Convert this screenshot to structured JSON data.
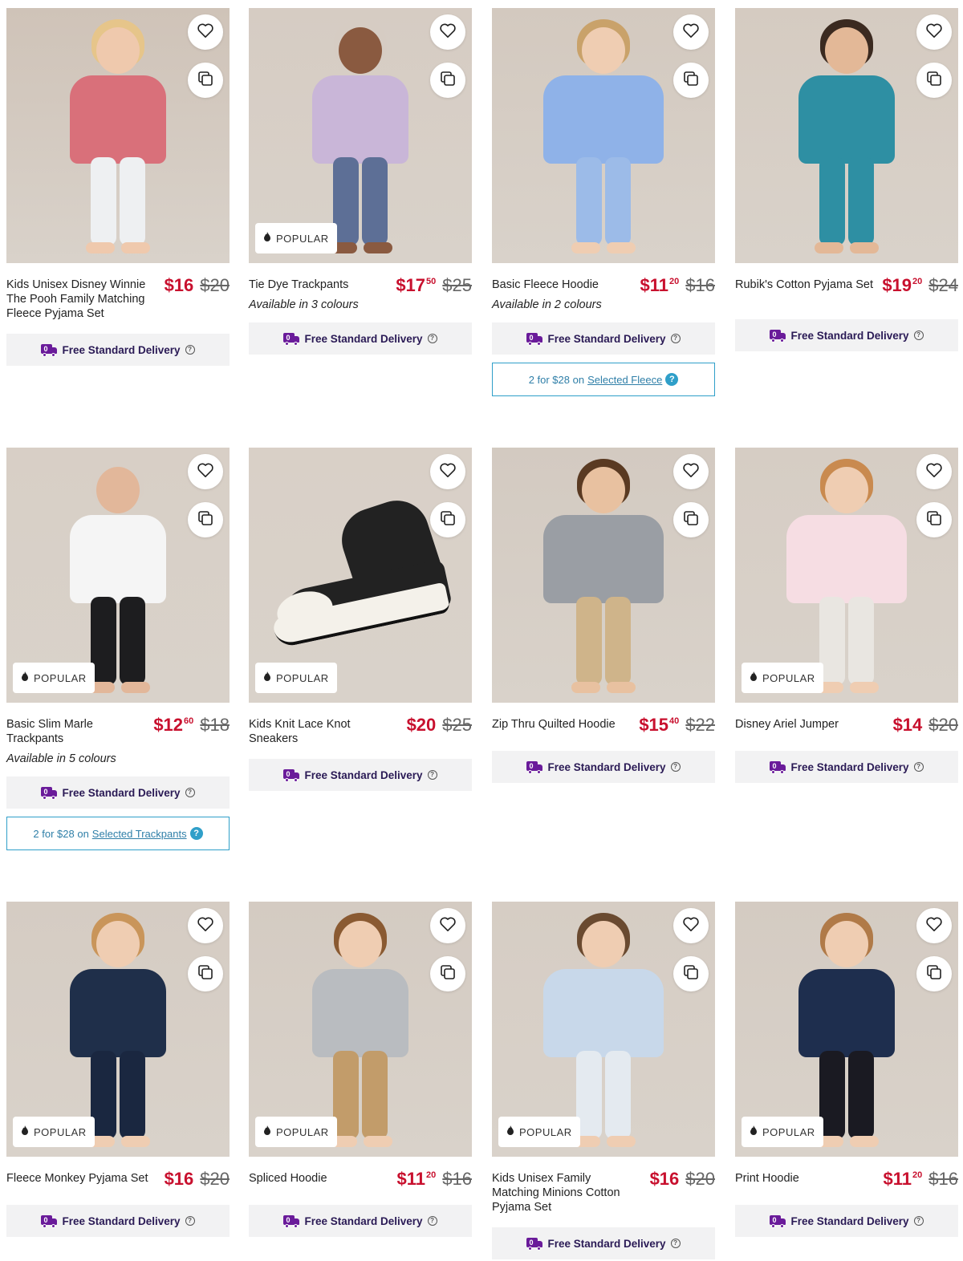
{
  "ui": {
    "popular_label": "POPULAR",
    "delivery_label": "Free Standard Delivery",
    "help_glyph": "?"
  },
  "products": [
    {
      "name": "Kids Unisex Disney Winnie The Pooh Family Matching Fleece Pyjama Set",
      "price_main": "$16",
      "price_cents": "",
      "was": "$20",
      "colours": "",
      "popular": false,
      "promo": null,
      "palette": {
        "bg": "#cfc3b8",
        "top": "#d9707a",
        "bottom": "#eef0f2",
        "hair": "#e6c58a",
        "skin": "#efc9ad"
      }
    },
    {
      "name": "Tie Dye Trackpants",
      "price_main": "$17",
      "price_cents": "50",
      "was": "$25",
      "colours": "Available in 3 colours",
      "popular": true,
      "promo": null,
      "palette": {
        "bg": "#d6ccc3",
        "top": "#c9b6d8",
        "bottom": "#5d6f96",
        "hair": "#d6ccc3",
        "skin": "#8a5a40"
      }
    },
    {
      "name": "Basic Fleece Hoodie",
      "price_main": "$11",
      "price_cents": "20",
      "was": "$16",
      "colours": "Available in 2 colours",
      "popular": false,
      "promo": {
        "prefix": "2 for $28 on",
        "link": "Selected Fleece"
      },
      "palette": {
        "bg": "#d3c9bf",
        "top": "#8fb2e8",
        "bottom": "#9cbbe8",
        "hair": "#c9a26a",
        "skin": "#efcdb2"
      }
    },
    {
      "name": "Rubik's Cotton Pyjama Set",
      "price_main": "$19",
      "price_cents": "20",
      "was": "$24",
      "colours": "",
      "popular": false,
      "promo": null,
      "palette": {
        "bg": "#d5cbc1",
        "top": "#2e8fa3",
        "bottom": "#2e8fa3",
        "hair": "#3b2a20",
        "skin": "#e3b897"
      }
    },
    {
      "name": "Basic Slim Marle Trackpants",
      "price_main": "$12",
      "price_cents": "60",
      "was": "$18",
      "colours": "Available in 5 colours",
      "popular": true,
      "promo": {
        "prefix": "2 for $28 on",
        "link": "Selected Trackpants"
      },
      "palette": {
        "bg": "#d8cfc6",
        "top": "#f5f5f5",
        "bottom": "#1d1d1f",
        "hair": "#d8cfc6",
        "skin": "#e2b79a"
      }
    },
    {
      "name": "Kids Knit Lace Knot Sneakers",
      "price_main": "$20",
      "price_cents": "",
      "was": "$25",
      "colours": "",
      "popular": true,
      "promo": null,
      "palette": {
        "bg": "#d9d0c7",
        "top": "#222222",
        "bottom": "#f4f1ea",
        "hair": "#d9d0c7",
        "skin": "#d9d0c7"
      }
    },
    {
      "name": "Zip Thru Quilted Hoodie",
      "price_main": "$15",
      "price_cents": "40",
      "was": "$22",
      "colours": "",
      "popular": false,
      "promo": null,
      "palette": {
        "bg": "#d3cac1",
        "top": "#9a9ea4",
        "bottom": "#cfb48a",
        "hair": "#5a3a22",
        "skin": "#e8c1a0"
      }
    },
    {
      "name": "Disney Ariel Jumper",
      "price_main": "$14",
      "price_cents": "",
      "was": "$20",
      "colours": "",
      "popular": true,
      "promo": null,
      "palette": {
        "bg": "#d6cdc4",
        "top": "#f6dde3",
        "bottom": "#e9e6e1",
        "hair": "#c98a4f",
        "skin": "#efcdb2"
      }
    },
    {
      "name": "Fleece Monkey Pyjama Set",
      "price_main": "$16",
      "price_cents": "",
      "was": "$20",
      "colours": "",
      "popular": true,
      "promo": null,
      "palette": {
        "bg": "#d5ccc3",
        "top": "#1f2f4a",
        "bottom": "#1a2740",
        "hair": "#c9955a",
        "skin": "#efcdb2"
      }
    },
    {
      "name": "Spliced Hoodie",
      "price_main": "$11",
      "price_cents": "20",
      "was": "$16",
      "colours": "",
      "popular": true,
      "promo": null,
      "palette": {
        "bg": "#d4cbc2",
        "top": "#b9bcc0",
        "bottom": "#c29c6a",
        "hair": "#8a5a32",
        "skin": "#efcdb2"
      }
    },
    {
      "name": "Kids Unisex Family Matching Minions Cotton Pyjama Set",
      "price_main": "$16",
      "price_cents": "",
      "was": "$20",
      "colours": "",
      "popular": true,
      "promo": null,
      "palette": {
        "bg": "#d6cdc4",
        "top": "#c8d8ea",
        "bottom": "#e4eaf0",
        "hair": "#6a4a30",
        "skin": "#efcdb2"
      }
    },
    {
      "name": "Print Hoodie",
      "price_main": "$11",
      "price_cents": "20",
      "was": "$16",
      "colours": "",
      "popular": true,
      "promo": null,
      "palette": {
        "bg": "#d4cbc2",
        "top": "#1e2e4e",
        "bottom": "#1a1a22",
        "hair": "#b07a48",
        "skin": "#efcdb2"
      }
    }
  ]
}
